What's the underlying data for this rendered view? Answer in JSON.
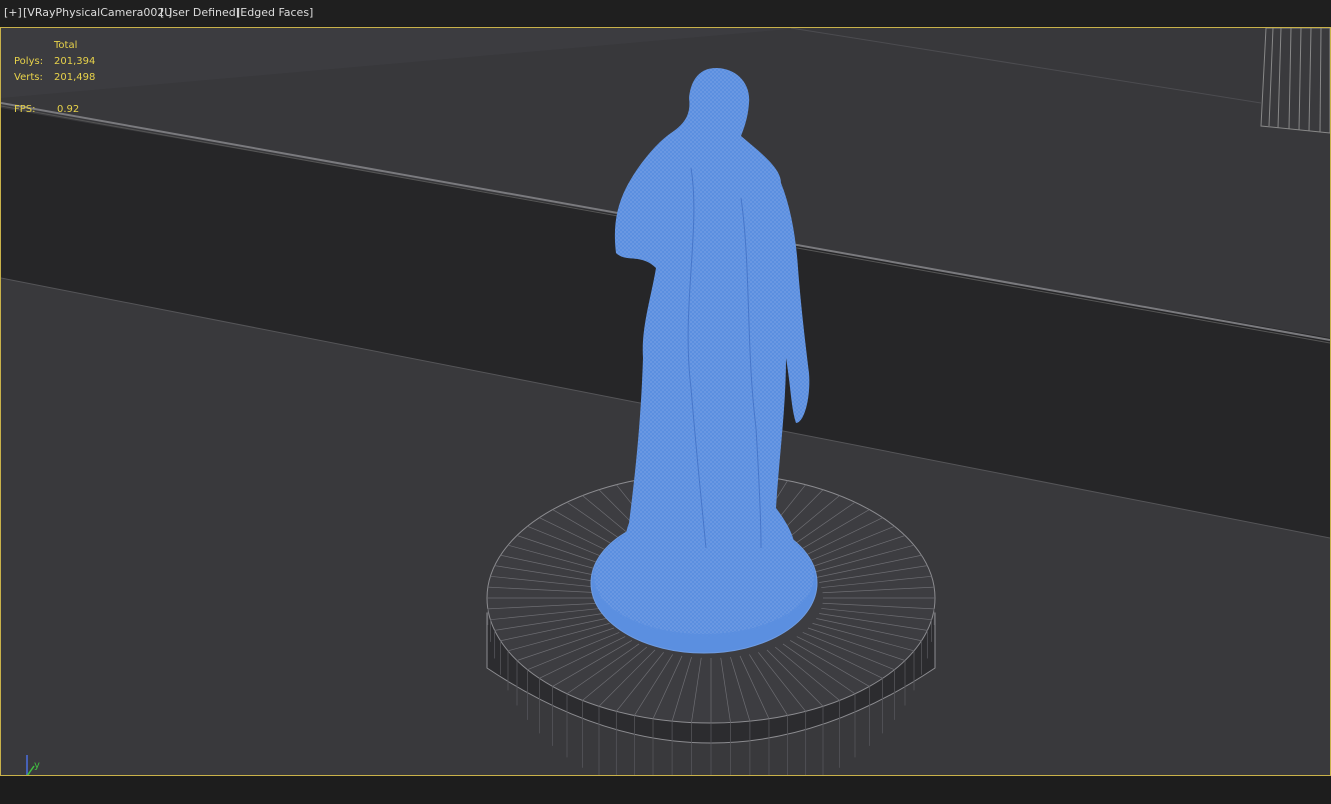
{
  "viewport_labels": {
    "menu": "[+]",
    "camera": "[VRayPhysicalCamera002 ]",
    "view_mode": "[User Defined]",
    "shading": "[Edged Faces]"
  },
  "statistics": {
    "header": "Total",
    "polys_label": "Polys:",
    "polys_value": "201,394",
    "verts_label": "Verts:",
    "verts_value": "201,498",
    "fps_label": "FPS:",
    "fps_value": "0.92"
  },
  "axis_gizmo": {
    "y_label": "y",
    "x_label": "x"
  },
  "colors": {
    "viewport_border": "#c9b24a",
    "stats_text": "#e7d24a",
    "statue": "#5b8fe0",
    "background": "#3a3a3d"
  }
}
